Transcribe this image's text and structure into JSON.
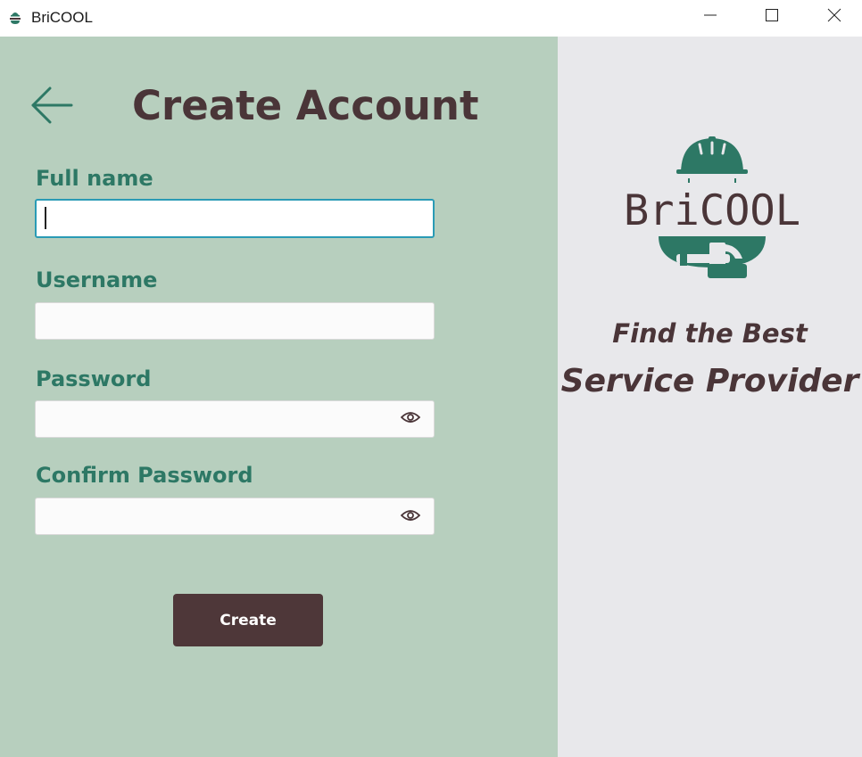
{
  "window": {
    "title": "BriCOOL",
    "icon": "bricool-app-icon",
    "controls": {
      "minimize": "minimize-icon",
      "maximize": "maximize-icon",
      "close": "close-icon"
    }
  },
  "form": {
    "back_icon": "back-arrow-icon",
    "title": "Create Account",
    "fields": {
      "full_name": {
        "label": "Full name",
        "value": ""
      },
      "username": {
        "label": "Username",
        "value": ""
      },
      "password": {
        "label": "Password",
        "value": "",
        "toggle_icon": "eye-icon"
      },
      "confirm_password": {
        "label": "Confirm Password",
        "value": "",
        "toggle_icon": "eye-icon"
      }
    },
    "create_label": "Create"
  },
  "brand": {
    "logo_text": "BriCOOL",
    "tagline_line1": "Find the Best",
    "tagline_line2": "Service Provider"
  },
  "colors": {
    "left_panel": "#b7cfbe",
    "right_panel": "#e8e8eb",
    "accent_green": "#2d7865",
    "dark_brown": "#4a3538",
    "button": "#4e3739",
    "focus_border": "#2a9bb5"
  }
}
